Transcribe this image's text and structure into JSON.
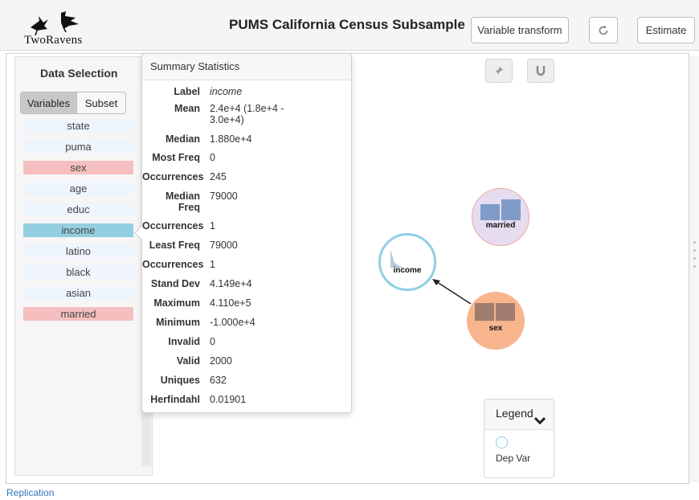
{
  "header": {
    "logo_text": "TwoRavens",
    "title": "PUMS California Census Subsample",
    "buttons": {
      "transform": "Variable transform",
      "reset_icon": "reset-icon",
      "estimate": "Estimate"
    }
  },
  "left_panel": {
    "title": "Data Selection",
    "tabs": [
      "Variables",
      "Subset"
    ],
    "active_tab": "Variables",
    "variables": [
      {
        "label": "state",
        "state": "none"
      },
      {
        "label": "puma",
        "state": "none"
      },
      {
        "label": "sex",
        "state": "red"
      },
      {
        "label": "age",
        "state": "none"
      },
      {
        "label": "educ",
        "state": "none"
      },
      {
        "label": "income",
        "state": "blue"
      },
      {
        "label": "latino",
        "state": "none"
      },
      {
        "label": "black",
        "state": "none"
      },
      {
        "label": "asian",
        "state": "none"
      },
      {
        "label": "married",
        "state": "red"
      }
    ]
  },
  "summary": {
    "title": "Summary Statistics",
    "rows": [
      {
        "label": "Label",
        "value": "income",
        "italic": true
      },
      {
        "label": "Mean",
        "value": "2.4e+4 (1.8e+4 - 3.0e+4)"
      },
      {
        "label": "Median",
        "value": "1.880e+4"
      },
      {
        "label": "Most Freq",
        "value": "0"
      },
      {
        "label": "Occurrences",
        "value": "245"
      },
      {
        "label": "Median Freq",
        "value": "79000"
      },
      {
        "label": "Occurrences",
        "value": "1"
      },
      {
        "label": "Least Freq",
        "value": "79000"
      },
      {
        "label": "Occurrences",
        "value": "1"
      },
      {
        "label": "Stand Dev",
        "value": "4.149e+4"
      },
      {
        "label": "Maximum",
        "value": "4.110e+5"
      },
      {
        "label": "Minimum",
        "value": "-1.000e+4"
      },
      {
        "label": "Invalid",
        "value": "0"
      },
      {
        "label": "Valid",
        "value": "2000"
      },
      {
        "label": "Uniques",
        "value": "632"
      },
      {
        "label": "Herfindahl",
        "value": "0.01901"
      }
    ]
  },
  "canvas": {
    "tools": [
      "pin-icon",
      "magnet-icon"
    ],
    "nodes": {
      "married": "married",
      "income": "income",
      "sex": "sex"
    },
    "colors": {
      "married": "#e5dcef",
      "sex": "#f8b48c",
      "income_border": "#8fcfe4",
      "bar": "#7f9cc9",
      "sex_bar": "#a07c6e"
    }
  },
  "legend": {
    "title": "Legend",
    "items": [
      {
        "label": "Dep Var"
      }
    ]
  },
  "footer": {
    "link": "Replication"
  }
}
